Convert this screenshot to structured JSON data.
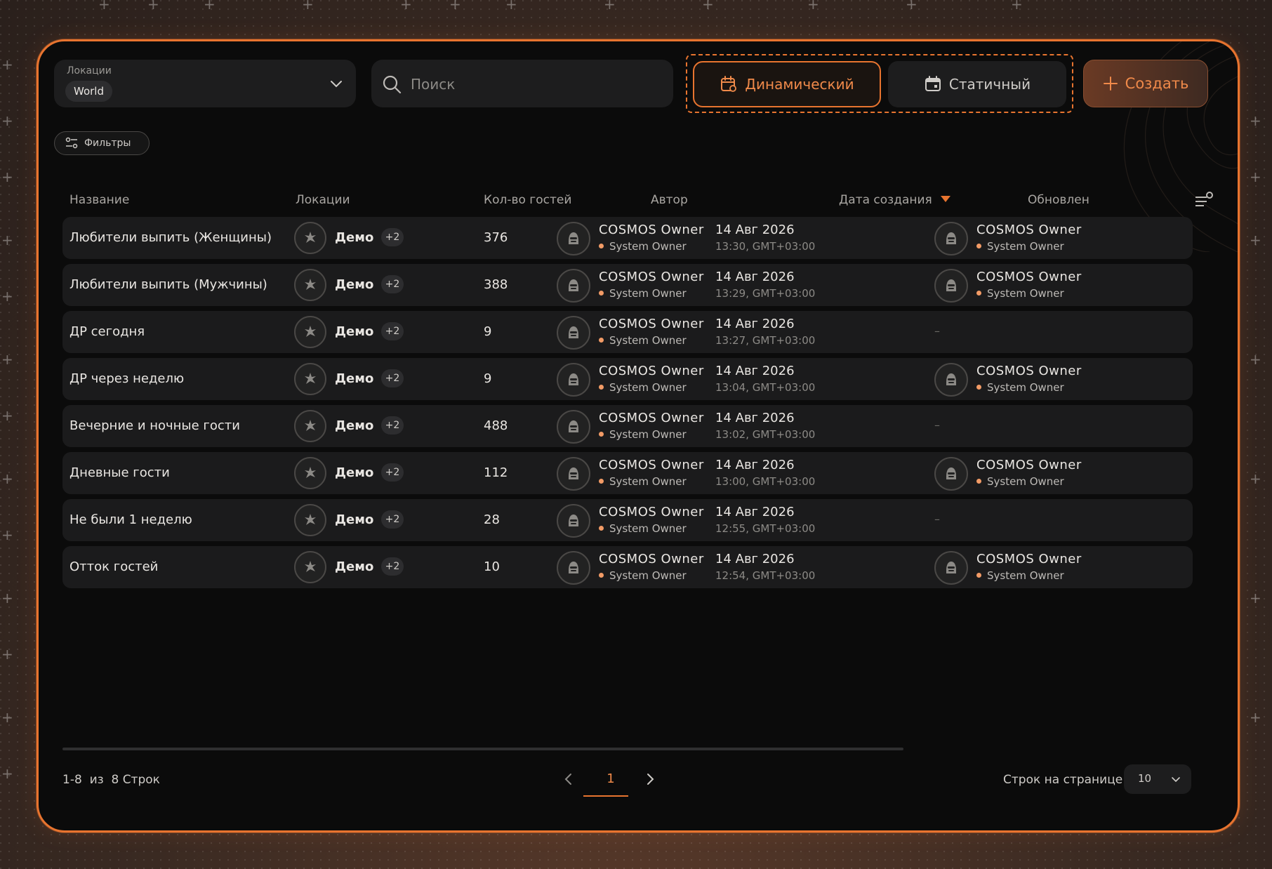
{
  "toolbar": {
    "location_label": "Локации",
    "location_value": "World",
    "search_placeholder": "Поиск",
    "mode_dynamic": "Динамический",
    "mode_static": "Статичный",
    "create_label": "Создать",
    "filters_label": "Фильтры"
  },
  "table": {
    "headers": {
      "name": "Название",
      "locations": "Локации",
      "guests": "Кол-во гостей",
      "author": "Автор",
      "created": "Дата создания",
      "updated": "Обновлен"
    },
    "rows": [
      {
        "name": "Любители выпить (Женщины)",
        "location": "Демо",
        "location_more": "+2",
        "guests": "376",
        "author": "COSMOS Owner",
        "author_role": "System Owner",
        "date": "14 Авг 2026",
        "time": "13:30, GMT+03:00",
        "updated_name": "COSMOS Owner",
        "updated_role": "System Owner",
        "updated_dash": ""
      },
      {
        "name": "Любители выпить (Мужчины)",
        "location": "Демо",
        "location_more": "+2",
        "guests": "388",
        "author": "COSMOS Owner",
        "author_role": "System Owner",
        "date": "14 Авг 2026",
        "time": "13:29, GMT+03:00",
        "updated_name": "COSMOS Owner",
        "updated_role": "System Owner",
        "updated_dash": ""
      },
      {
        "name": "ДР сегодня",
        "location": "Демо",
        "location_more": "+2",
        "guests": "9",
        "author": "COSMOS Owner",
        "author_role": "System Owner",
        "date": "14 Авг 2026",
        "time": "13:27, GMT+03:00",
        "updated_name": "",
        "updated_role": "",
        "updated_dash": "–"
      },
      {
        "name": "ДР через неделю",
        "location": "Демо",
        "location_more": "+2",
        "guests": "9",
        "author": "COSMOS Owner",
        "author_role": "System Owner",
        "date": "14 Авг 2026",
        "time": "13:04, GMT+03:00",
        "updated_name": "COSMOS Owner",
        "updated_role": "System Owner",
        "updated_dash": ""
      },
      {
        "name": "Вечерние и ночные гости",
        "location": "Демо",
        "location_more": "+2",
        "guests": "488",
        "author": "COSMOS Owner",
        "author_role": "System Owner",
        "date": "14 Авг 2026",
        "time": "13:02, GMT+03:00",
        "updated_name": "",
        "updated_role": "",
        "updated_dash": "–"
      },
      {
        "name": "Дневные гости",
        "location": "Демо",
        "location_more": "+2",
        "guests": "112",
        "author": "COSMOS Owner",
        "author_role": "System Owner",
        "date": "14 Авг 2026",
        "time": "13:00, GMT+03:00",
        "updated_name": "COSMOS Owner",
        "updated_role": "System Owner",
        "updated_dash": ""
      },
      {
        "name": "Не были 1 неделю",
        "location": "Демо",
        "location_more": "+2",
        "guests": "28",
        "author": "COSMOS Owner",
        "author_role": "System Owner",
        "date": "14 Авг 2026",
        "time": "12:55, GMT+03:00",
        "updated_name": "",
        "updated_role": "",
        "updated_dash": "–"
      },
      {
        "name": "Отток гостей",
        "location": "Демо",
        "location_more": "+2",
        "guests": "10",
        "author": "COSMOS Owner",
        "author_role": "System Owner",
        "date": "14 Авг 2026",
        "time": "12:54, GMT+03:00",
        "updated_name": "COSMOS Owner",
        "updated_role": "System Owner",
        "updated_dash": ""
      }
    ]
  },
  "footer": {
    "range": "1-8  из  8 Строк",
    "page": "1",
    "rows_per_page_label": "Строк на странице",
    "rows_per_page_value": "10"
  },
  "colors": {
    "accent": "#e8742f",
    "background": "#0b0b0b",
    "row": "#1b1b1c"
  },
  "icons": [
    "chevron-down-icon",
    "search-icon",
    "calendar-refresh-icon",
    "calendar-icon",
    "plus-icon",
    "sliders-icon",
    "sort-desc-icon",
    "column-settings-icon",
    "location-avatar-icon",
    "user-avatar-icon",
    "chevron-left-icon",
    "chevron-right-icon"
  ]
}
